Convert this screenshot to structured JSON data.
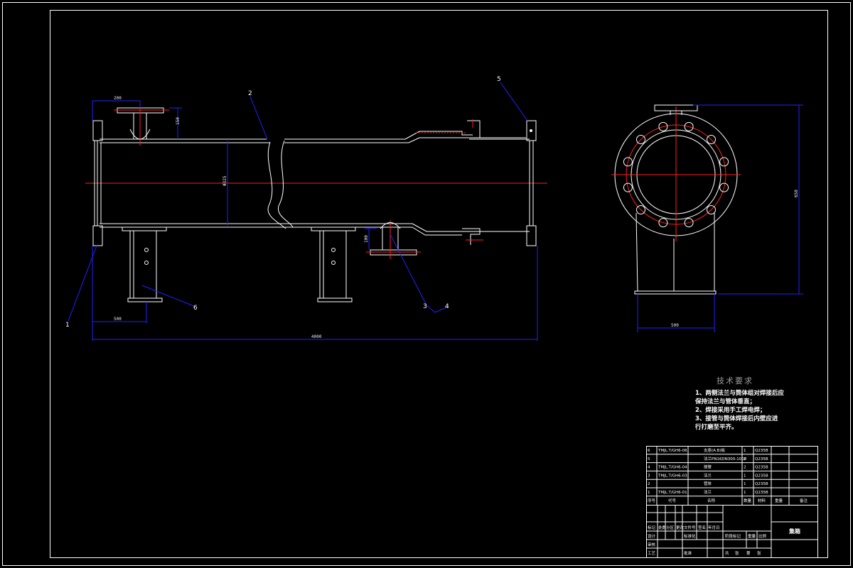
{
  "colors": {
    "background": "#000000",
    "outline": "#ffffff",
    "dimension": "#2222ff",
    "centerline": "#ff2020",
    "hatch": "#ff3030",
    "note_title": "#9a9a9a"
  },
  "front_view": {
    "callouts": [
      "1",
      "2",
      "3",
      "4",
      "5",
      "6"
    ],
    "dimensions": {
      "nozzle_offset": "200",
      "nozzle_height": "150",
      "shell_diameter": "Φ325",
      "support_offset": "500",
      "overall_length": "4000",
      "bottom_nozzle_height": "100"
    }
  },
  "side_view": {
    "dimensions": {
      "height": "650",
      "base_width": "500"
    }
  },
  "technical_notes": {
    "title": "技术要求",
    "lines": [
      "1、两侧法兰与筒体组对焊接后应",
      "    保持法兰与管体垂直；",
      "2、焊接采用手工焊电焊；",
      "3、接管与筒体焊接后内壁应进",
      "    行打磨至平齐。"
    ]
  },
  "parts_list": {
    "rows": [
      {
        "no": "6",
        "code": "TMJL.T/GH6-06",
        "name": "支座(A.B)板",
        "qty": "1",
        "material": "Q235B"
      },
      {
        "no": "5",
        "code": "",
        "name": "法兰PN16DN300-1000",
        "qty": "2",
        "material": "Q235B"
      },
      {
        "no": "4",
        "code": "TMJL.T/GH6-04",
        "name": "接管",
        "qty": "2",
        "material": "Q235B"
      },
      {
        "no": "3",
        "code": "TMJL.T/GH6-03",
        "name": "法兰",
        "qty": "1",
        "material": "Q235B"
      },
      {
        "no": "2",
        "code": "",
        "name": "管体",
        "qty": "1",
        "material": "Q235B"
      },
      {
        "no": "1",
        "code": "TMJL.T/GH6-01",
        "name": "法兰",
        "qty": "1",
        "material": "Q235B"
      }
    ],
    "header": [
      "序号",
      "代号",
      "名称",
      "数量",
      "材料",
      "重量",
      "备注"
    ]
  },
  "title_block": {
    "drawing_title": "集箱",
    "labels": [
      "标记",
      "处数",
      "分区",
      "更改文件号",
      "签名",
      "年月日",
      "设计",
      "标准化",
      "阶段标记",
      "重量",
      "比例",
      "审核",
      "工艺",
      "批准",
      "共",
      "张",
      "第",
      "张"
    ]
  }
}
